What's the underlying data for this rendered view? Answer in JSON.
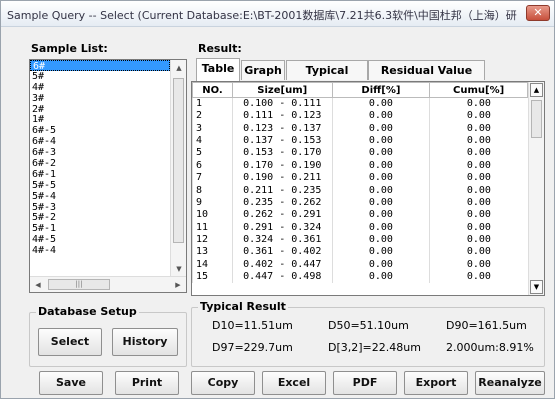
{
  "window": {
    "title": "Sample Query -- Select    (Current Database:E:\\BT-2001数据库\\7.21共6.3软件\\中国杜邦（上海）研发中心.mdb)",
    "close_label": "✕"
  },
  "sample_list": {
    "label": "Sample List:",
    "items": [
      "6#",
      "5#",
      "4#",
      "3#",
      "2#",
      "1#",
      "6#-5",
      "6#-4",
      "6#-3",
      "6#-2",
      "6#-1",
      "5#-5",
      "5#-4",
      "5#-3",
      "5#-2",
      "5#-1",
      "4#-5",
      "4#-4"
    ],
    "selected_index": 0,
    "hscroll_thumb": "|||"
  },
  "database_setup": {
    "label": "Database Setup",
    "select_label": "Select",
    "history_label": "History"
  },
  "result": {
    "label": "Result:",
    "tabs": [
      "Table",
      "Graph",
      "Typical Result",
      "Residual Value Graph"
    ],
    "active_tab": 0,
    "columns": [
      "NO.",
      "Size[um]",
      "Diff[%]",
      "Cumu[%]"
    ],
    "rows": [
      [
        "1",
        "0.100 - 0.111",
        "0.00",
        "0.00"
      ],
      [
        "2",
        "0.111 - 0.123",
        "0.00",
        "0.00"
      ],
      [
        "3",
        "0.123 - 0.137",
        "0.00",
        "0.00"
      ],
      [
        "4",
        "0.137 - 0.153",
        "0.00",
        "0.00"
      ],
      [
        "5",
        "0.153 - 0.170",
        "0.00",
        "0.00"
      ],
      [
        "6",
        "0.170 - 0.190",
        "0.00",
        "0.00"
      ],
      [
        "7",
        "0.190 - 0.211",
        "0.00",
        "0.00"
      ],
      [
        "8",
        "0.211 - 0.235",
        "0.00",
        "0.00"
      ],
      [
        "9",
        "0.235 - 0.262",
        "0.00",
        "0.00"
      ],
      [
        "10",
        "0.262 - 0.291",
        "0.00",
        "0.00"
      ],
      [
        "11",
        "0.291 - 0.324",
        "0.00",
        "0.00"
      ],
      [
        "12",
        "0.324 - 0.361",
        "0.00",
        "0.00"
      ],
      [
        "13",
        "0.361 - 0.402",
        "0.00",
        "0.00"
      ],
      [
        "14",
        "0.402 - 0.447",
        "0.00",
        "0.00"
      ],
      [
        "15",
        "0.447 - 0.498",
        "0.00",
        "0.00"
      ]
    ]
  },
  "typical_result": {
    "label": "Typical Result",
    "d10": "D10=11.51um",
    "d50": "D50=51.10um",
    "d90": "D90=161.5um",
    "d97": "D97=229.7um",
    "d32": "D[3,2]=22.48um",
    "ratio": "2.000um:8.91%"
  },
  "bottom_buttons": {
    "save": "Save",
    "print": "Print",
    "copy": "Copy",
    "excel": "Excel",
    "pdf": "PDF",
    "export": "Export",
    "reanalyze": "Reanalyze"
  },
  "icons": {
    "scroll_up": "up-arrow-icon",
    "scroll_down": "down-arrow-icon",
    "scroll_left": "left-arrow-icon",
    "scroll_right": "right-arrow-icon"
  }
}
